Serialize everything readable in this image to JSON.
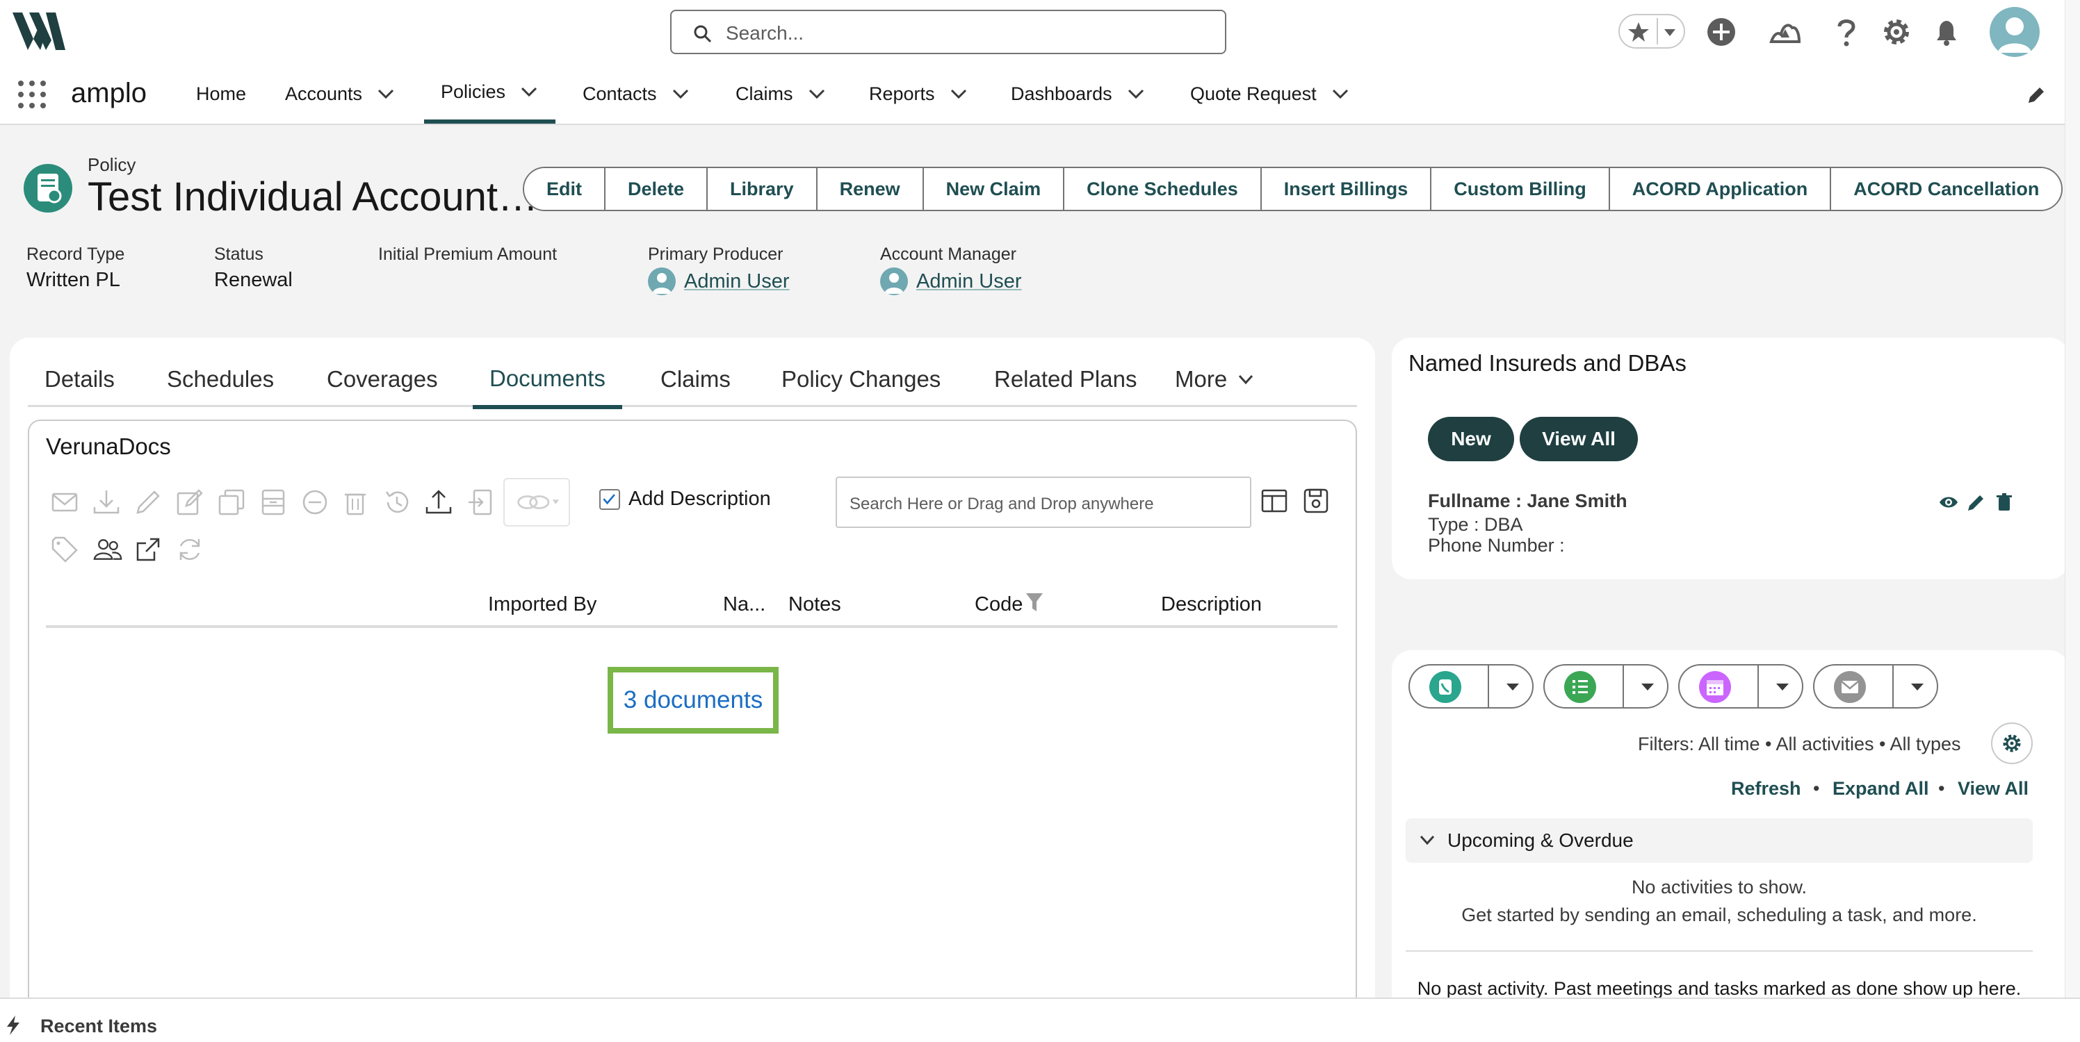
{
  "header": {
    "search_placeholder": "Search...",
    "icons": [
      "favorites-star-icon",
      "add-icon",
      "trailhead-icon",
      "help-icon",
      "setup-gear-icon",
      "notifications-bell-icon",
      "user-avatar"
    ]
  },
  "nav": {
    "app_name": "amplo",
    "items": [
      {
        "label": "Home"
      },
      {
        "label": "Accounts"
      },
      {
        "label": "Policies"
      },
      {
        "label": "Contacts"
      },
      {
        "label": "Claims"
      },
      {
        "label": "Reports"
      },
      {
        "label": "Dashboards"
      },
      {
        "label": "Quote Request"
      }
    ],
    "active": "Policies"
  },
  "record": {
    "type_label": "Policy",
    "title": "Test Individual Account…",
    "actions": [
      "Edit",
      "Delete",
      "Library",
      "Renew",
      "New Claim",
      "Clone Schedules",
      "Insert Billings",
      "Custom Billing",
      "ACORD Application",
      "ACORD Cancellation"
    ],
    "highlights": {
      "record_type_label": "Record Type",
      "record_type_value": "Written PL",
      "status_label": "Status",
      "status_value": "Renewal",
      "initial_premium_label": "Initial Premium Amount",
      "primary_producer_label": "Primary Producer",
      "primary_producer_value": "Admin User",
      "account_manager_label": "Account Manager",
      "account_manager_value": "Admin User"
    }
  },
  "tabs": [
    "Details",
    "Schedules",
    "Coverages",
    "Documents",
    "Claims",
    "Policy Changes",
    "Related Plans",
    "More"
  ],
  "active_tab": "Documents",
  "docs": {
    "title": "VerunaDocs",
    "add_description_label": "Add Description",
    "add_description_checked": true,
    "search_placeholder": "Search Here or Drag and Drop anywhere",
    "columns": [
      "Imported By",
      "Na...",
      "Notes",
      "Code",
      "Description"
    ],
    "count_text": "3 documents"
  },
  "named_insureds": {
    "title": "Named Insureds and DBAs",
    "new_label": "New",
    "view_all_label": "View All",
    "fullname": "Fullname : Jane Smith",
    "type": "Type : DBA",
    "phone": "Phone Number :"
  },
  "activity": {
    "filters_text": "Filters: All time • All activities • All types",
    "refresh_label": "Refresh",
    "expand_all_label": "Expand All",
    "view_all_label": "View All",
    "dot": "•",
    "upcoming_label": "Upcoming & Overdue",
    "no_activities": "No activities to show.",
    "get_started": "Get started by sending an email, scheduling a task, and more.",
    "no_past": "No past activity. Past meetings and tasks marked as done show up here."
  },
  "utility_bar": {
    "recent_items_label": "Recent Items"
  },
  "colors": {
    "brand_dark": "#1f4e52",
    "pill_button": "#1f3f40",
    "highlight_box": "#7ab648",
    "link_blue": "#1b6ec2",
    "call_icon": "#2aa58e",
    "task_icon": "#3ba755",
    "event_icon": "#cb65ff",
    "email_icon": "#939393"
  }
}
